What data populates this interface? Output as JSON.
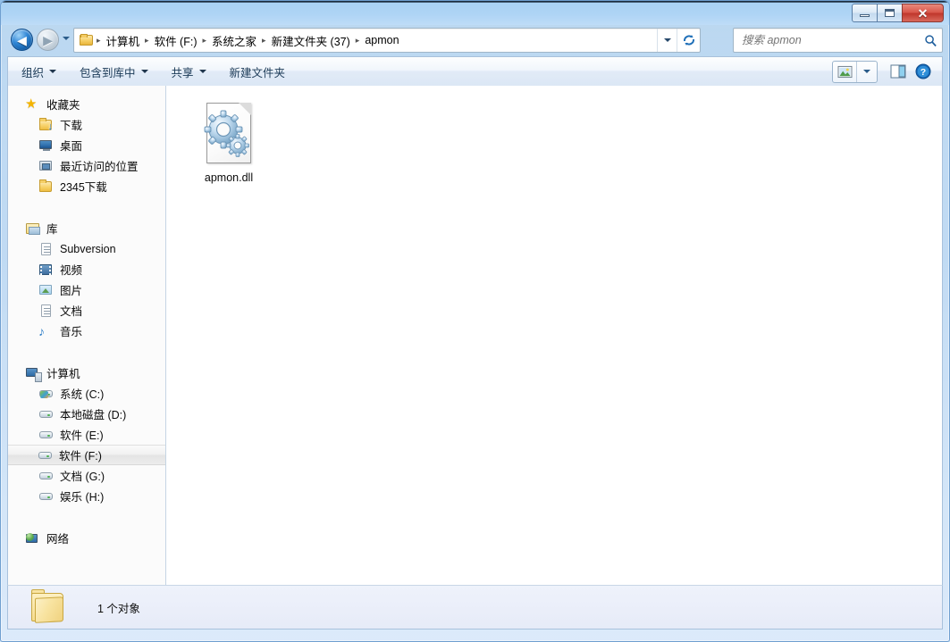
{
  "window": {
    "title": "apmon",
    "controls": {
      "minimize": "–",
      "restore": "❐",
      "close": "✕"
    }
  },
  "nav": {
    "back_label": "◀",
    "forward_label": "▶",
    "history_label": "▾",
    "refresh_label": "refresh",
    "breadcrumb": {
      "icon": "folder-icon",
      "items": [
        {
          "label": "计算机"
        },
        {
          "label": "软件 (F:)"
        },
        {
          "label": "系统之家"
        },
        {
          "label": "新建文件夹 (37)"
        },
        {
          "label": "apmon"
        }
      ],
      "separator": "▸"
    },
    "search": {
      "placeholder": "搜索 apmon",
      "value": "",
      "icon": "search-icon"
    }
  },
  "toolbar": {
    "items": [
      {
        "label": "组织",
        "caret": true,
        "name": "organize"
      },
      {
        "label": "包含到库中",
        "caret": true,
        "name": "include-in-library"
      },
      {
        "label": "共享",
        "caret": true,
        "name": "share-with"
      },
      {
        "label": "新建文件夹",
        "caret": false,
        "name": "new-folder"
      }
    ],
    "right": {
      "view_icon": "view-options-icon",
      "view_caret": "▾",
      "preview_icon": "preview-pane-icon",
      "help_icon": "help-icon",
      "help_glyph": "?"
    }
  },
  "sidebar": {
    "groups": [
      {
        "name": "favorites",
        "header": {
          "label": "收藏夹",
          "icon": "star-icon"
        },
        "items": [
          {
            "label": "下载",
            "icon": "folder-download-icon"
          },
          {
            "label": "桌面",
            "icon": "desktop-icon"
          },
          {
            "label": "最近访问的位置",
            "icon": "recent-places-icon"
          },
          {
            "label": "2345下载",
            "icon": "folder-icon"
          }
        ]
      },
      {
        "name": "libraries",
        "header": {
          "label": "库",
          "icon": "library-icon"
        },
        "items": [
          {
            "label": "Subversion",
            "icon": "document-icon"
          },
          {
            "label": "视频",
            "icon": "video-icon"
          },
          {
            "label": "图片",
            "icon": "pictures-icon"
          },
          {
            "label": "文档",
            "icon": "documents-icon"
          },
          {
            "label": "音乐",
            "icon": "music-icon"
          }
        ]
      },
      {
        "name": "computer",
        "header": {
          "label": "计算机",
          "icon": "computer-icon"
        },
        "items": [
          {
            "label": "系统 (C:)",
            "icon": "system-drive-icon",
            "selected": false
          },
          {
            "label": "本地磁盘 (D:)",
            "icon": "drive-icon",
            "selected": false
          },
          {
            "label": "软件 (E:)",
            "icon": "drive-icon",
            "selected": false
          },
          {
            "label": "软件 (F:)",
            "icon": "drive-icon",
            "selected": true
          },
          {
            "label": "文档 (G:)",
            "icon": "drive-icon",
            "selected": false
          },
          {
            "label": "娱乐 (H:)",
            "icon": "drive-icon",
            "selected": false
          }
        ]
      },
      {
        "name": "network",
        "header": {
          "label": "网络",
          "icon": "network-icon"
        },
        "items": []
      }
    ]
  },
  "content": {
    "files": [
      {
        "label": "apmon.dll",
        "icon": "dll-file-icon"
      }
    ]
  },
  "statusbar": {
    "icon": "folder-icon",
    "text": "1 个对象"
  },
  "colors": {
    "title_bar": "#aed4f5",
    "frame": "#b1d2f0",
    "close_button": "#c0372c",
    "selection": "#ececec",
    "status_bar": "#eef2fb",
    "accent_blue": "#2f86d6"
  }
}
